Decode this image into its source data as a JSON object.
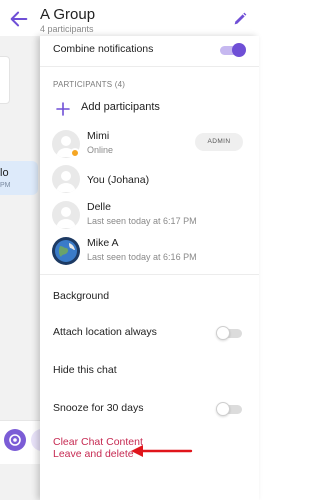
{
  "header": {
    "title": "A Group",
    "subtitle": "4 participants",
    "back_icon": "arrow-left-icon",
    "edit_icon": "pencil-icon"
  },
  "chat_background": {
    "bubble_text": "lo",
    "bubble_time": "PM",
    "voice_icon": "microphone-icon"
  },
  "settings": {
    "combine_notifications": {
      "label": "Combine notifications",
      "enabled": true
    }
  },
  "participants": {
    "header": "PARTICIPANTS (4)",
    "add_label": "Add participants",
    "members": [
      {
        "name": "Mimi",
        "status": "Online",
        "badge": "ADMIN",
        "online": true
      },
      {
        "name": "You (Johana)",
        "status": ""
      },
      {
        "name": "Delle",
        "status": "Last seen today at 6:17 PM"
      },
      {
        "name": "Mike A",
        "status": "Last seen today at 6:16 PM"
      }
    ]
  },
  "options": {
    "background": "Background",
    "attach_location": {
      "label": "Attach location always",
      "enabled": false
    },
    "hide_chat": "Hide this chat",
    "snooze": {
      "label": "Snooze for 30 days",
      "enabled": false
    },
    "clear_chat": "Clear Chat Content",
    "leave_delete": "Leave and delete"
  },
  "colors": {
    "accent": "#6f4fd6",
    "danger": "#c62a52",
    "online": "#f5a623",
    "annotation": "#e0151b"
  }
}
